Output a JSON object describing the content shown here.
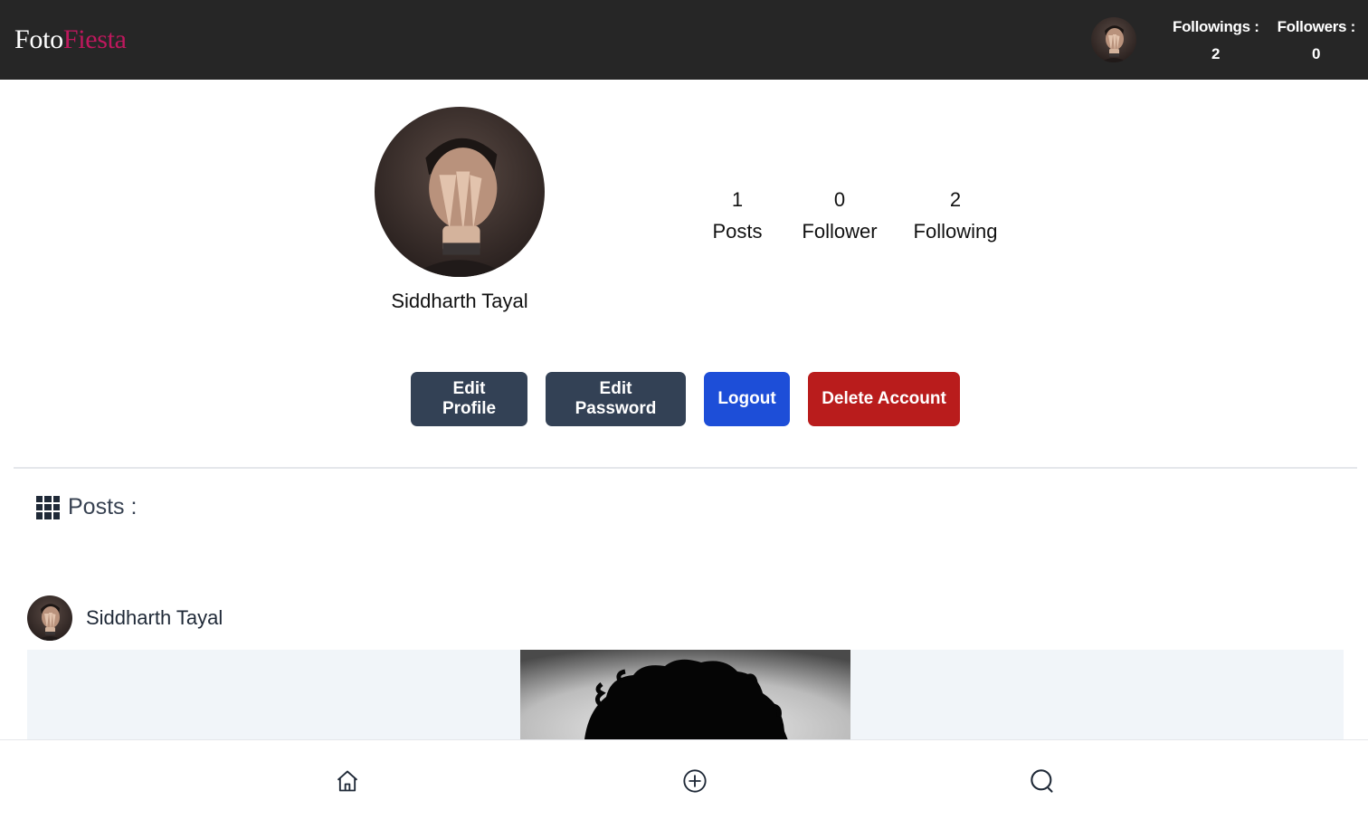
{
  "header": {
    "brand_part1": "Foto",
    "brand_part2": "Fiesta",
    "followings_label": "Followings :",
    "followings_value": "2",
    "followers_label": "Followers :",
    "followers_value": "0"
  },
  "profile": {
    "name": "Siddharth Tayal",
    "stats": [
      {
        "value": "1",
        "label": "Posts"
      },
      {
        "value": "0",
        "label": "Follower"
      },
      {
        "value": "2",
        "label": "Following"
      }
    ]
  },
  "actions": {
    "edit_profile": "Edit Profile",
    "edit_password": "Edit Password",
    "logout": "Logout",
    "delete_account": "Delete Account"
  },
  "posts_section": {
    "heading": "Posts :",
    "icon": "grid-icon"
  },
  "post": {
    "author": "Siddharth Tayal"
  },
  "bottom_nav": {
    "items": [
      {
        "icon": "home-icon"
      },
      {
        "icon": "plus-circle-icon"
      },
      {
        "icon": "search-icon"
      }
    ]
  },
  "colors": {
    "header_bg": "#262626",
    "brand_accent": "#be185d",
    "slate_button": "#334155",
    "logout_button": "#1d4ed8",
    "delete_button": "#b91c1c"
  }
}
